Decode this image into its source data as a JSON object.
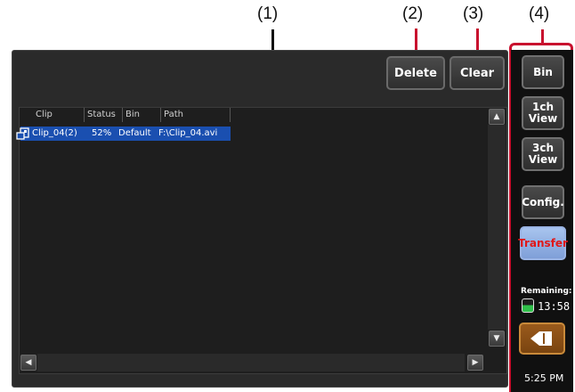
{
  "callouts": [
    "(1)",
    "(2)",
    "(3)",
    "(4)"
  ],
  "toolbar": {
    "delete_label": "Delete",
    "clear_label": "Clear"
  },
  "clip_list": {
    "columns": [
      "Clip",
      "Status",
      "Bin",
      "Path"
    ],
    "rows": [
      {
        "clip": "Clip_04(2)",
        "status": "52%",
        "bin": "Default",
        "path": "F:\\Clip_04.avi",
        "icon": "clip-transfer-icon",
        "selected": true
      }
    ]
  },
  "sidebar": {
    "bin_label": "Bin",
    "view1_label": "1ch\nView",
    "view3_label": "3ch\nView",
    "config_label": "Config.",
    "transfer_label": "Transfer",
    "remaining_label": "Remaining:",
    "remaining_time": "13:58",
    "back_icon": "back-arrow-icon",
    "clock": "5:25 PM"
  },
  "colors": {
    "callout_lead": "#c8102e",
    "selection": "#1a4fb0",
    "transfer_text": "#e01818",
    "transfer_bg": "#a8c4ee",
    "back_button": "#8a4e16"
  }
}
